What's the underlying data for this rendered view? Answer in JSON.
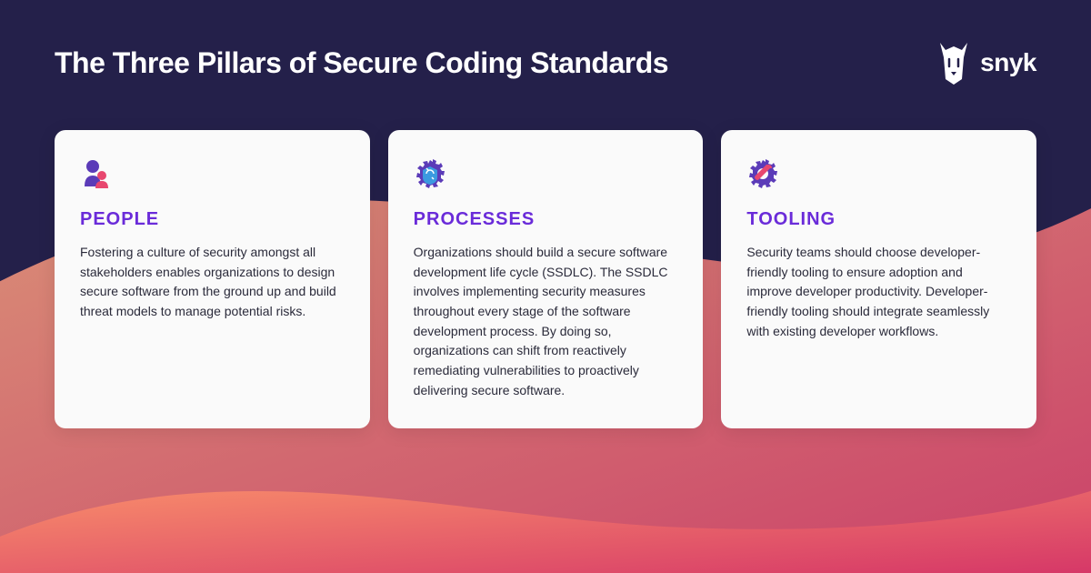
{
  "header": {
    "title": "The Three Pillars  of Secure Coding Standards",
    "logo_text": "snyk"
  },
  "colors": {
    "bg_dark": "#24204a",
    "accent_purple": "#6a2bd9",
    "wave_orange": "#f88c6b",
    "wave_pink": "#e8476f",
    "card_bg": "#fafafa"
  },
  "pillars": [
    {
      "icon": "people-icon",
      "title": "PEOPLE",
      "body": "Fostering a culture of security amongst all stakeholders enables organizations to design secure software from the ground up and build threat models to manage potential risks."
    },
    {
      "icon": "processes-icon",
      "title": "PROCESSES",
      "body": "Organizations should build a secure software development life cycle (SSDLC). The SSDLC involves implementing security measures throughout every stage of the software development process. By doing so, organizations can shift from reactively remediating vulnerabilities to proactively delivering secure software."
    },
    {
      "icon": "tooling-icon",
      "title": "TOOLING",
      "body": "Security teams should choose developer-friendly tooling to ensure adoption and improve developer productivity. Developer-friendly tooling should integrate seamlessly with existing developer workflows."
    }
  ]
}
